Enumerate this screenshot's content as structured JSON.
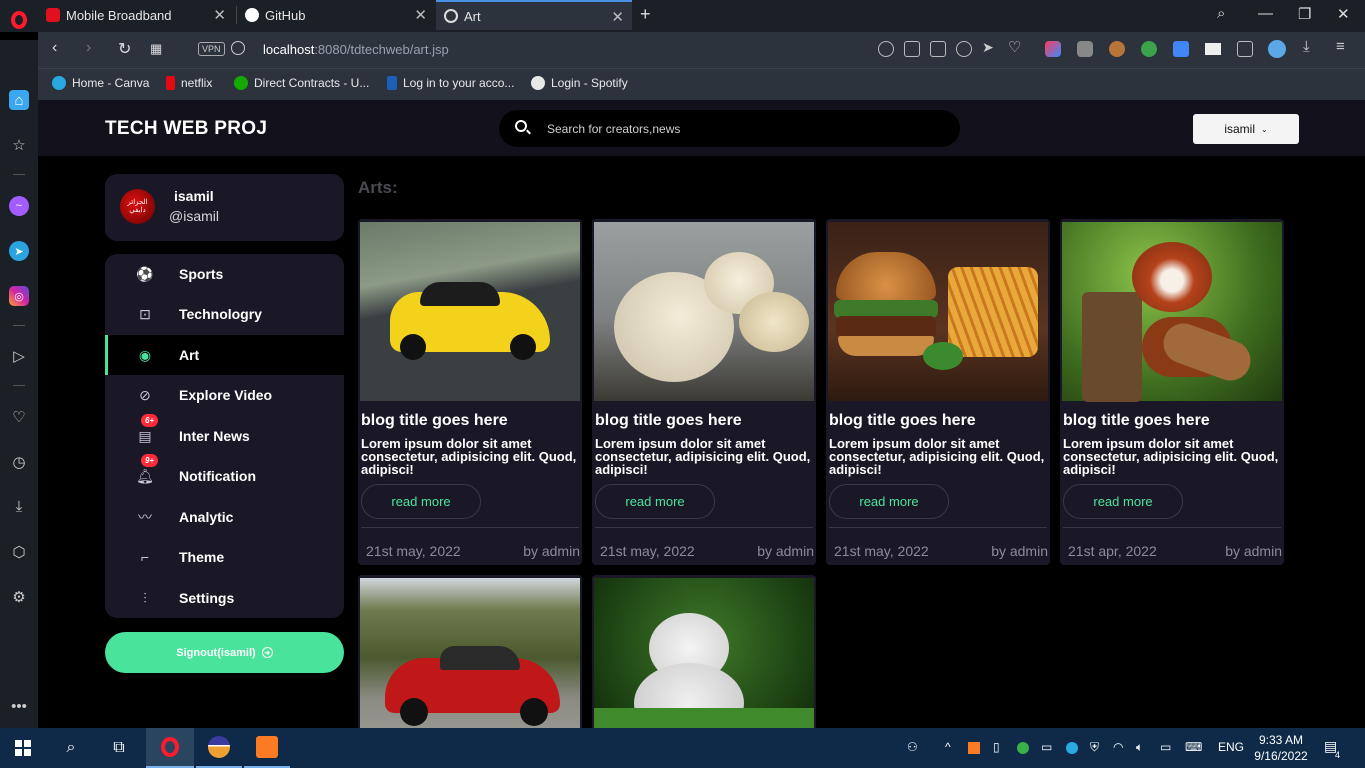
{
  "browser": {
    "tabs": [
      {
        "label": "Mobile Broadband",
        "favicon": "huawei-icon",
        "active": false
      },
      {
        "label": "GitHub",
        "favicon": "github-icon",
        "active": false
      },
      {
        "label": "Art",
        "favicon": "globe-icon",
        "active": true
      }
    ],
    "url_host": "localhost",
    "url_rest": ":8080/tdtechweb/art.jsp",
    "vpn_label": "VPN",
    "bookmarks": [
      {
        "label": "Home - Canva",
        "color": "#2aa8e0"
      },
      {
        "label": "netflix",
        "color": "#e50914"
      },
      {
        "label": "Direct Contracts - U...",
        "color": "#14a800"
      },
      {
        "label": "Log in to your acco...",
        "color": "#1b5fb8"
      },
      {
        "label": "Login - Spotify",
        "color": "#e8e8e8"
      }
    ]
  },
  "header": {
    "brand": "TECH WEB PROJ",
    "search_placeholder": "Search for creators,news",
    "user_button": "isamil"
  },
  "profile": {
    "name": "isamil",
    "handle": "@isamil",
    "avatar_text": "الجزائر دايفي"
  },
  "menu": {
    "items": [
      {
        "label": "Sports",
        "icon": "soccer-ball-icon"
      },
      {
        "label": "Technologry",
        "icon": "robot-icon"
      },
      {
        "label": "Art",
        "icon": "palette-icon",
        "active": true
      },
      {
        "label": "Explore Video",
        "icon": "compass-icon"
      },
      {
        "label": "Inter News",
        "icon": "news-icon",
        "badge": "6+"
      },
      {
        "label": "Notification",
        "icon": "bell-icon",
        "badge": "9+"
      },
      {
        "label": "Analytic",
        "icon": "chart-line-icon"
      },
      {
        "label": "Theme",
        "icon": "paint-roller-icon"
      },
      {
        "label": "Settings",
        "icon": "sliders-icon"
      }
    ],
    "signout": "Signout(isamil)"
  },
  "main": {
    "heading": "Arts:",
    "cards": [
      {
        "title": "blog title goes here",
        "body": "Lorem ipsum dolor sit amet consectetur, adipisicing elit. Quod, adipisci!",
        "read_more": "read more",
        "date": "21st may, 2022",
        "author": "by admin",
        "image": "yellow-sports-car"
      },
      {
        "title": "blog title goes here",
        "body": "Lorem ipsum dolor sit amet consectetur, adipisicing elit. Quod, adipisci!",
        "read_more": "read more",
        "date": "21st may, 2022",
        "author": "by admin",
        "image": "chicks"
      },
      {
        "title": "blog title goes here",
        "body": "Lorem ipsum dolor sit amet consectetur, adipisicing elit. Quod, adipisci!",
        "read_more": "read more",
        "date": "21st may, 2022",
        "author": "by admin",
        "image": "burger-and-fries"
      },
      {
        "title": "blog title goes here",
        "body": "Lorem ipsum dolor sit amet consectetur, adipisicing elit. Quod, adipisci!",
        "read_more": "read more",
        "date": "21st apr, 2022",
        "author": "by admin",
        "image": "red-panda"
      }
    ],
    "partial_cards": [
      {
        "image": "red-sports-car"
      },
      {
        "image": "white-kitten"
      }
    ]
  },
  "taskbar": {
    "time": "9:33 AM",
    "date": "9/16/2022",
    "language": "ENG",
    "notifications": "4"
  },
  "colors": {
    "accent": "#4ae39b",
    "badge": "#ff2b3a",
    "card_bg": "#1a1826",
    "nav_bg": "#13121c"
  }
}
